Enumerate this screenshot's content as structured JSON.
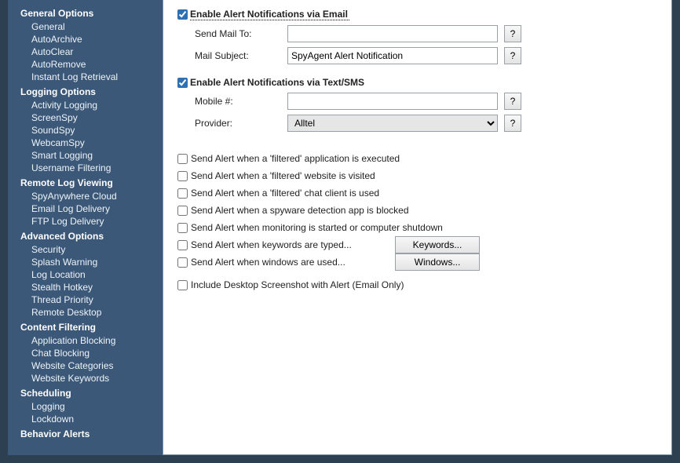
{
  "sidebar": {
    "sections": [
      {
        "header": "General Options",
        "items": [
          "General",
          "AutoArchive",
          "AutoClear",
          "AutoRemove",
          "Instant Log Retrieval"
        ]
      },
      {
        "header": "Logging Options",
        "items": [
          "Activity Logging",
          "ScreenSpy",
          "SoundSpy",
          "WebcamSpy",
          "Smart Logging",
          "Username Filtering"
        ]
      },
      {
        "header": "Remote Log Viewing",
        "items": [
          "SpyAnywhere Cloud",
          "Email Log Delivery",
          "FTP Log Delivery"
        ]
      },
      {
        "header": "Advanced Options",
        "items": [
          "Security",
          "Splash Warning",
          "Log Location",
          "Stealth Hotkey",
          "Thread Priority",
          "Remote Desktop"
        ]
      },
      {
        "header": "Content Filtering",
        "items": [
          "Application Blocking",
          "Chat Blocking",
          "Website Categories",
          "Website Keywords"
        ]
      },
      {
        "header": "Scheduling",
        "items": [
          "Logging",
          "Lockdown"
        ]
      },
      {
        "header": "Behavior Alerts",
        "items": []
      }
    ]
  },
  "content": {
    "emailSection": {
      "enable": {
        "label": "Enable Alert Notifications via Email",
        "checked": true
      },
      "sendMailTo": {
        "label": "Send Mail To:",
        "value": "",
        "help": "?"
      },
      "mailSubject": {
        "label": "Mail Subject:",
        "value": "SpyAgent Alert Notification",
        "help": "?"
      }
    },
    "smsSection": {
      "enable": {
        "label": "Enable Alert Notifications via Text/SMS",
        "checked": true
      },
      "mobile": {
        "label": "Mobile #:",
        "value": "",
        "help": "?"
      },
      "provider": {
        "label": "Provider:",
        "value": "Alltel",
        "help": "?"
      }
    },
    "alerts": [
      {
        "label": "Send Alert when a 'filtered' application is executed",
        "checked": false
      },
      {
        "label": "Send Alert when a 'filtered' website is visited",
        "checked": false
      },
      {
        "label": "Send Alert when a 'filtered' chat client is used",
        "checked": false
      },
      {
        "label": "Send Alert when a spyware detection app is blocked",
        "checked": false
      },
      {
        "label": "Send Alert when monitoring is started or computer shutdown",
        "checked": false
      },
      {
        "label": "Send Alert when keywords are typed...",
        "checked": false,
        "button": "Keywords..."
      },
      {
        "label": "Send Alert when windows are used...",
        "checked": false,
        "button": "Windows..."
      }
    ],
    "includeScreenshot": {
      "label": "Include Desktop Screenshot with Alert (Email Only)",
      "checked": false
    }
  }
}
